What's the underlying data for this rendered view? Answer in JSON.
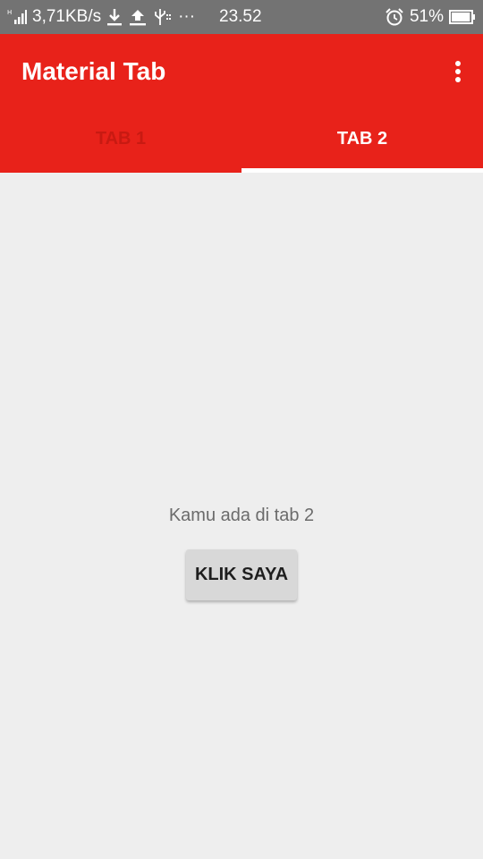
{
  "status_bar": {
    "speed": "3,71KB/s",
    "more": "···",
    "time": "23.52",
    "battery_percent": "51%",
    "battery_level": 0.51,
    "icons": [
      "signal-icon",
      "download-icon",
      "upload-icon",
      "usb-icon",
      "alarm-icon",
      "battery-icon"
    ]
  },
  "app_bar": {
    "title": "Material Tab",
    "menu_icon": "overflow-menu-icon",
    "color": "#e8221a"
  },
  "tabs": [
    {
      "label": "TAB 1",
      "selected": false
    },
    {
      "label": "TAB 2",
      "selected": true
    }
  ],
  "content": {
    "message": "Kamu ada di tab 2",
    "button_label": "KLIK SAYA"
  }
}
